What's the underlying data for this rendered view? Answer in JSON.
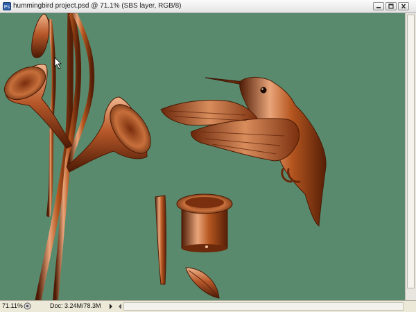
{
  "window": {
    "title": "hummingbird project.psd @ 71.1% (SBS layer, RGB/8)"
  },
  "status": {
    "zoom": "71.11%",
    "doc": "Doc: 3.24M/78.3M"
  },
  "colors": {
    "canvas_bg": "#5a8a6d",
    "copper_light": "#e7a77c",
    "copper_mid": "#b9602d",
    "copper_dark": "#5a2309"
  },
  "icons": [
    "photoshop-icon",
    "minimize-icon",
    "restore-icon",
    "close-icon",
    "status-icon",
    "arrow-right-icon",
    "arrow-left-icon",
    "mouse-cursor-icon"
  ]
}
